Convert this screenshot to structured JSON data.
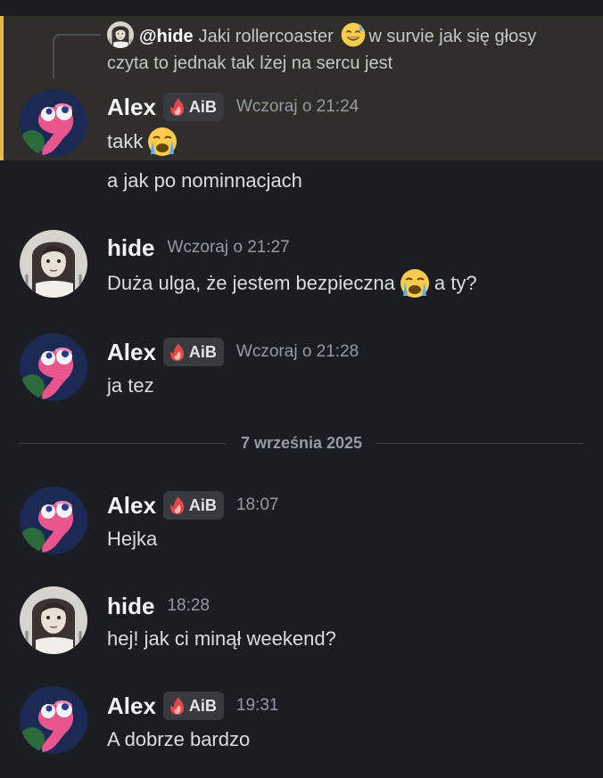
{
  "reply": {
    "mention": "@hide",
    "text_before": "Jaki rollercoaster",
    "emoji": "sweat-smile-emoji",
    "text_after": "w survie jak się głosy",
    "text_line2": "czyta to jednak tak lżej na sercu jest"
  },
  "colors": {
    "background": "#1c1d22",
    "highlight": "#2f2e2a",
    "highlight_bar": "#e8b84a",
    "timestamp": "#949ba4",
    "tag_background": "#383a40"
  },
  "tag_label": "AiB",
  "messages": [
    {
      "author": "Alex",
      "time": "Wczoraj o 21:24",
      "lines": [
        "takk"
      ],
      "emoji": "loudly-crying-emoji"
    },
    {
      "continuation": "a jak po nominnacjach"
    },
    {
      "author": "hide",
      "time": "Wczoraj o 21:27",
      "text_before": "Duża ulga, że jestem bezpieczna",
      "emoji": "loudly-crying-emoji",
      "text_after": "a ty?"
    },
    {
      "author": "Alex",
      "time": "Wczoraj o 21:28",
      "text": "ja tez"
    },
    {
      "date_divider": "7 września 2025"
    },
    {
      "author": "Alex",
      "time": "18:07",
      "text": "Hejka"
    },
    {
      "author": "hide",
      "time": "18:28",
      "text": "hej! jak ci minął weekend?"
    },
    {
      "author": "Alex",
      "time": "19:31",
      "text": "A dobrze bardzo"
    }
  ]
}
